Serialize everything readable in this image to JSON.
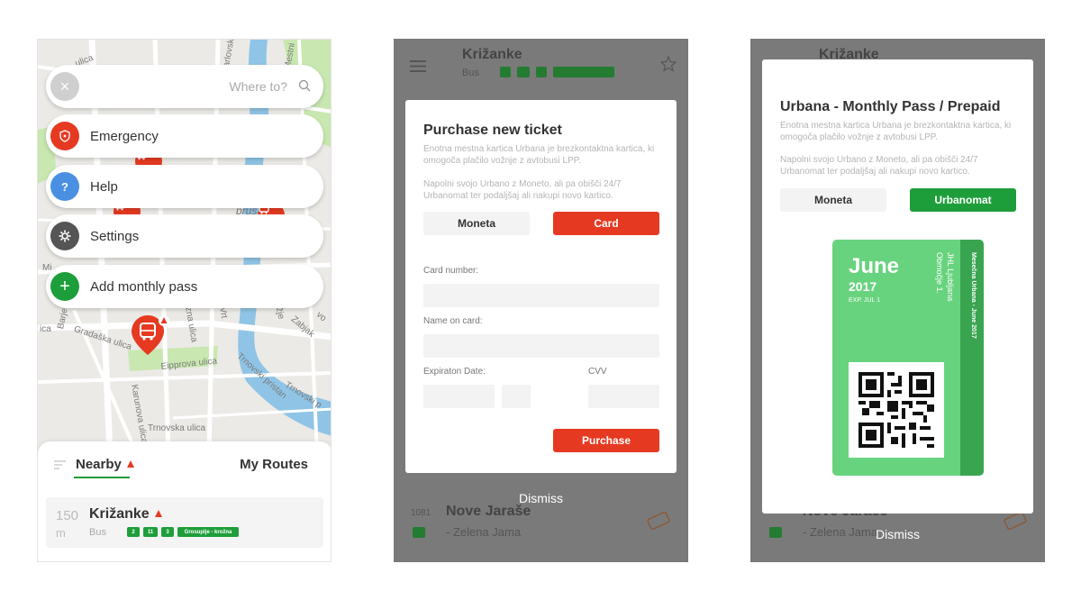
{
  "screen1": {
    "map_labels": {
      "ulica_top": "ulica",
      "karlovska": "Karlovska",
      "mestni": "Mestni",
      "prus": "prus",
      "mi": "Mi",
      "barje": "Barje",
      "ica": "ica",
      "gradaska": "Gradaška ulica",
      "zna": "zna ulica",
      "vrt": "Vrt",
      "rezje": "Režje",
      "zabjak": "Zabjak",
      "vo": "vo",
      "tr": "tr",
      "eipprova": "Eipprova ulica",
      "karunova": "Karunova ulica",
      "trnovski_pristan": "Trnovski pristan",
      "trnovski_pr2": "Trnovski p",
      "trnovska": "Trnovska ulica"
    },
    "search": {
      "placeholder": "Where to?",
      "close_icon": "×"
    },
    "menu": [
      {
        "label": "Emergency",
        "color": "#e53a21",
        "icon": "shield-icon"
      },
      {
        "label": "Help",
        "color": "#4a90e2",
        "icon": "question-icon"
      },
      {
        "label": "Settings",
        "color": "#555555",
        "icon": "gear-icon"
      },
      {
        "label": "Add monthly pass",
        "color": "#1e9e3a",
        "icon": "plus-icon"
      }
    ],
    "tabs": {
      "nearby": "Nearby",
      "my_routes": "My Routes"
    },
    "stop": {
      "distance": "150",
      "unit": "m",
      "name": "Križanke",
      "type": "Bus",
      "lines": [
        "2",
        "11",
        "3",
        "Grosuplje - krožna"
      ]
    }
  },
  "screen2": {
    "bg": {
      "stop_top": "Križanke",
      "stop_top_type": "Bus",
      "stop_bottom": "Nove Jaraše",
      "stop_bottom_dest": "- Zelena Jama",
      "stop_bottom_dist": "1081"
    },
    "modal": {
      "title": "Purchase new ticket",
      "desc1": "Enotna mestna kartica Urbana je brezkontaktna kartica, ki omogoča plačilo vožnje z avtobusi LPP.",
      "desc2": "Napolni svojo Urbano z Moneto, ali pa obišči 24/7 Urbanomat ter podaljšaj ali nakupi novo kartico.",
      "tab_moneta": "Moneta",
      "tab_card": "Card",
      "card_number_label": "Card number:",
      "name_label": "Name on card:",
      "expiration_label": "Expiraton Date:",
      "cvv_label": "CVV",
      "purchase": "Purchase"
    },
    "dismiss": "Dismiss"
  },
  "screen3": {
    "bg": {
      "stop_top": "Križanke",
      "stop_bottom": "Nove Jarače",
      "stop_bottom_dest": "- Zelena Jama"
    },
    "modal": {
      "title": "Urbana - Monthly Pass / Prepaid",
      "desc1": "Enotna mestna kartica Urbana je brezkontaktna kartica, ki omogoča plačilo vožnje z avtobusi LPP.",
      "desc2": "Napolni svojo Urbano z Moneto, ali pa obišči 24/7 Urbanomat ter podaljšaj ali nakupi novo kartico.",
      "tab_moneta": "Moneta",
      "tab_urbanomat": "Urbanomat"
    },
    "pass": {
      "month": "June",
      "year": "2017",
      "exp": "EXP. JUL 1",
      "issuer": "JHL Ljubljana",
      "zone": "Območje 1.",
      "strip": "Mesečna Urbana - June 2017"
    },
    "dismiss": "Dismiss"
  },
  "colors": {
    "accent_red": "#e53a21",
    "accent_green": "#1e9e3a",
    "pass_green": "#68d37e"
  }
}
